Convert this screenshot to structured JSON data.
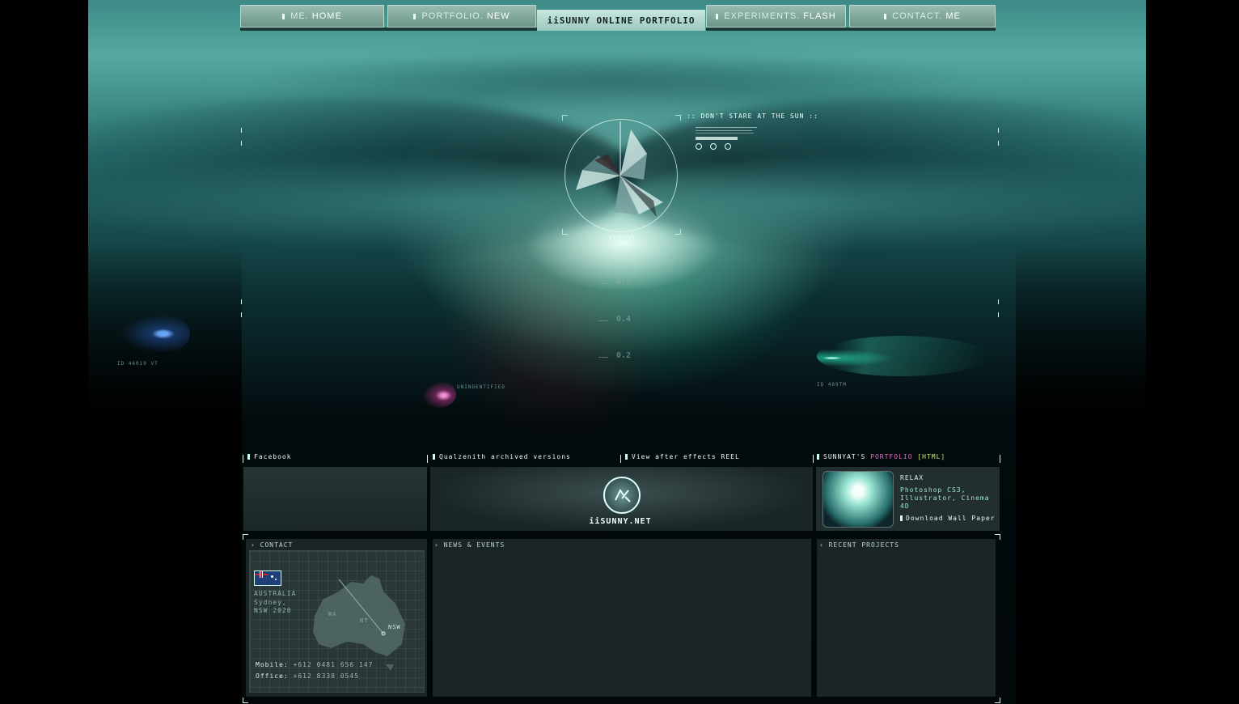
{
  "nav": {
    "items": [
      {
        "pre": "ME.",
        "suf": "HOME"
      },
      {
        "pre": "PORTFOLIO.",
        "suf": "NEW"
      },
      {
        "pre": "EXPERIMENTS.",
        "suf": "FLASH"
      },
      {
        "pre": "CONTACT.",
        "suf": "ME"
      }
    ],
    "site_title": "iiSUNNY ONLINE PORTFOLIO"
  },
  "hud": {
    "caption": ":: DON'T STARE AT THE SUN ::",
    "scale": [
      "0.6",
      "0.4",
      "0.2"
    ],
    "label_left": "ID 46019 VT",
    "label_mid": "UNINDENTIFIED",
    "label_right": "ID 469TM"
  },
  "links": {
    "facebook": "Facebook",
    "archived": "Qualzenith archived versions",
    "reel": "View after effects REEL",
    "portfolio_pre": "SUNNYAT'S ",
    "portfolio_mid": "PORTFOLIO",
    "portfolio_suf": " [HTML]"
  },
  "banner": {
    "logo_text": "iiSUNNY.NET"
  },
  "wallpaper": {
    "title": "RELAX",
    "tools": "Photoshop CS3, Illustrator, Cinema 4D",
    "download": "Download Wall Paper"
  },
  "sections": {
    "contact": "CONTACT",
    "news": "NEWS & EVENTS",
    "recent": "RECENT PROJECTS"
  },
  "contact": {
    "country": "AUSTRALIA",
    "city": "Sydney,",
    "state": "NSW 2020",
    "mobile_label": "Mobile:",
    "mobile": "+612 0481 656 147",
    "office_label": "Office:",
    "office": "+612 8338 0545",
    "map_labels": [
      "WA",
      "NT",
      "NSW"
    ]
  },
  "colors": {
    "accent": "#9fe7d6",
    "portfolio_pink": "#e271c8",
    "html_green": "#c6e87a"
  }
}
